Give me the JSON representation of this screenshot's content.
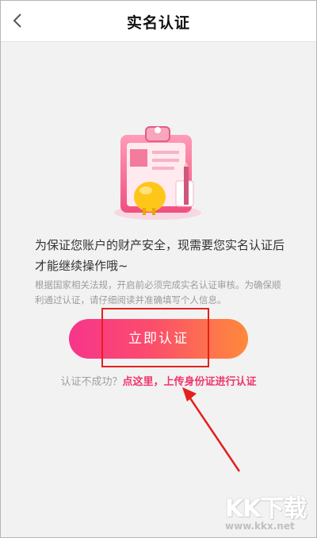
{
  "header": {
    "title": "实名认证",
    "back_icon": "chevron-left-icon"
  },
  "illustration": {
    "name": "clipboard-id-card-illustration"
  },
  "main_message": "为保证您账户的财产安全，现需要您实名认证后才能继续操作哦~",
  "sub_message": "根据国家相关法规，开启前必须完成实名认证审核。为确保顺利通过认证，请仔细阅读并准确填写个人信息。",
  "verify_button": {
    "label": "立即认证"
  },
  "fail_line": {
    "question": "认证不成功？",
    "link": "点这里，上传身份证进行认证"
  },
  "watermark": {
    "brand": "KK下载",
    "url": "www.kkx.net"
  },
  "colors": {
    "accent_pink": "#f7358a",
    "accent_orange": "#ff8a3a",
    "link_pink": "#f0356b",
    "annotation_red": "#e2211c"
  }
}
